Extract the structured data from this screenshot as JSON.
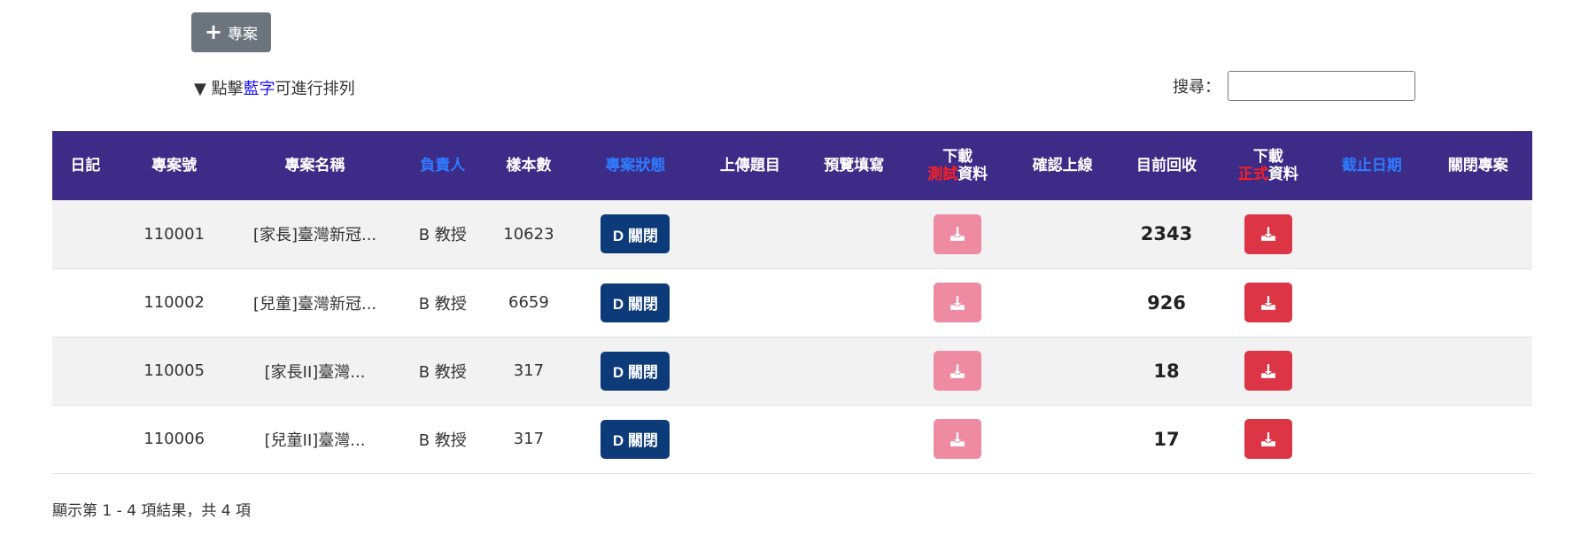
{
  "toolbar": {
    "add_label": "專案"
  },
  "sort_hint": {
    "prefix": "▼ 點擊",
    "highlight": "藍字",
    "suffix": "可進行排列"
  },
  "search": {
    "label": "搜尋：",
    "value": ""
  },
  "table": {
    "headers": {
      "diary": "日記",
      "project_no": "專案號",
      "project_name": "專案名稱",
      "owner": "負責人",
      "samples": "樣本數",
      "status": "專案狀態",
      "upload": "上傳題目",
      "preview": "預覽填寫",
      "dl_test_line1": "下載",
      "dl_test_red": "測試",
      "dl_test_rest": "資料",
      "confirm": "確認上線",
      "returns": "目前回收",
      "dl_formal_line1": "下載",
      "dl_formal_red": "正式",
      "dl_formal_rest": "資料",
      "deadline": "截止日期",
      "close": "關閉專案"
    },
    "rows": [
      {
        "project_no": "110001",
        "project_name": "[家長]臺灣新冠...",
        "owner": "B 教授",
        "samples": "10623",
        "status": "D 關閉",
        "returns": "2343"
      },
      {
        "project_no": "110002",
        "project_name": "[兒童]臺灣新冠...",
        "owner": "B 教授",
        "samples": "6659",
        "status": "D 關閉",
        "returns": "926"
      },
      {
        "project_no": "110005",
        "project_name": "[家長II]臺灣...",
        "owner": "B 教授",
        "samples": "317",
        "status": "D 關閉",
        "returns": "18"
      },
      {
        "project_no": "110006",
        "project_name": "[兒童II]臺灣...",
        "owner": "B 教授",
        "samples": "317",
        "status": "D 關閉",
        "returns": "17"
      }
    ]
  },
  "summary": "顯示第 1 - 4 項結果，共 4 項",
  "colors": {
    "header_bg": "#3c2b87",
    "sortable_header": "#2e7cff",
    "status_button": "#0d3b7a",
    "download_test": "#ef8aa3",
    "download_formal": "#dc3545"
  },
  "icons": {
    "add": "plus-icon",
    "download": "download-icon"
  }
}
